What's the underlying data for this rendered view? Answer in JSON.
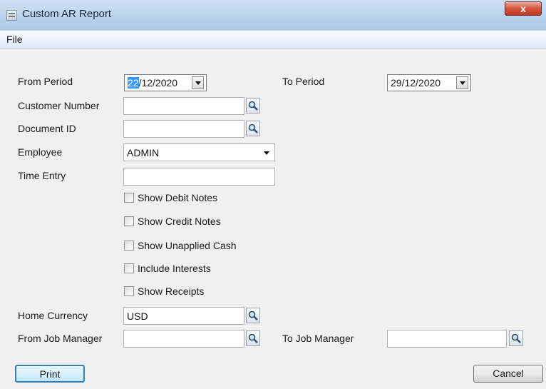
{
  "window": {
    "title": "Custom AR Report",
    "close_glyph": "x"
  },
  "menu": {
    "file": "File"
  },
  "form": {
    "from_period_label": "From Period",
    "from_period_day": "22",
    "from_period_rest": "/12/2020",
    "to_period_label": "To Period",
    "to_period_value": "29/12/2020",
    "customer_number_label": "Customer Number",
    "customer_number_value": "",
    "document_id_label": "Document ID",
    "document_id_value": "",
    "employee_label": "Employee",
    "employee_value": "ADMIN",
    "time_entry_label": "Time Entry",
    "time_entry_value": "",
    "checkboxes": [
      {
        "label": "Show Debit Notes",
        "checked": false
      },
      {
        "label": "Show Credit Notes",
        "checked": false
      },
      {
        "label": "Show Unapplied Cash",
        "checked": false
      },
      {
        "label": "Include Interests",
        "checked": false
      },
      {
        "label": "Show Receipts",
        "checked": false
      }
    ],
    "home_currency_label": "Home Currency",
    "home_currency_value": "USD",
    "from_job_manager_label": "From Job Manager",
    "from_job_manager_value": "",
    "to_job_manager_label": "To Job Manager",
    "to_job_manager_value": ""
  },
  "buttons": {
    "print": "Print",
    "cancel": "Cancel"
  },
  "icons": {
    "lookup": "magnifier-icon",
    "dropdown": "chevron-down-icon",
    "app": "report-icon"
  }
}
